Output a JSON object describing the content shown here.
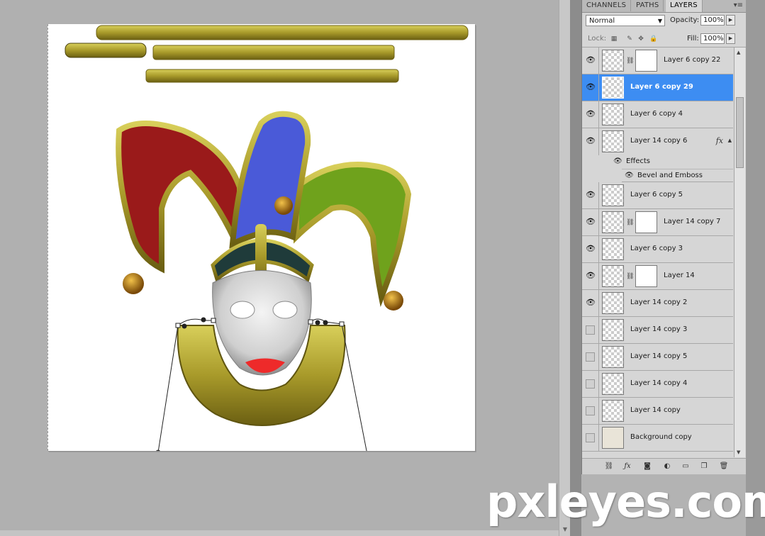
{
  "panel": {
    "tabs": [
      "CHANNELS",
      "PATHS",
      "LAYERS"
    ],
    "blend_mode": "Normal",
    "opacity_label": "Opacity:",
    "opacity_value": "100%",
    "lock_label": "Lock:",
    "fill_label": "Fill:",
    "fill_value": "100%"
  },
  "layers": [
    {
      "name": "Layer 6 copy 22",
      "visible": true,
      "mask": true,
      "selected": false
    },
    {
      "name": "Layer 6 copy 29",
      "visible": true,
      "mask": false,
      "selected": true
    },
    {
      "name": "Layer 6 copy 4",
      "visible": true,
      "mask": false,
      "selected": false
    },
    {
      "name": "Layer 14 copy 6",
      "visible": true,
      "mask": false,
      "selected": false,
      "fx": "fx"
    },
    {
      "name": "Layer 6 copy 5",
      "visible": true,
      "mask": false,
      "selected": false
    },
    {
      "name": "Layer 14 copy 7",
      "visible": true,
      "mask": true,
      "selected": false
    },
    {
      "name": "Layer 6 copy 3",
      "visible": true,
      "mask": false,
      "selected": false
    },
    {
      "name": "Layer 14",
      "visible": true,
      "mask": true,
      "selected": false
    },
    {
      "name": "Layer 14 copy 2",
      "visible": true,
      "mask": false,
      "selected": false
    },
    {
      "name": "Layer 14 copy 3",
      "visible": false,
      "mask": false,
      "selected": false
    },
    {
      "name": "Layer 14 copy 5",
      "visible": false,
      "mask": false,
      "selected": false
    },
    {
      "name": "Layer 14 copy 4",
      "visible": false,
      "mask": false,
      "selected": false
    },
    {
      "name": "Layer 14 copy",
      "visible": false,
      "mask": false,
      "selected": false
    },
    {
      "name": "Background copy",
      "visible": false,
      "mask": false,
      "selected": false
    }
  ],
  "effects": {
    "effects_label": "Effects",
    "bevel_label": "Bevel and Emboss"
  },
  "watermark": "pxleyes.com",
  "colors": {
    "selection": "#3d8df2",
    "gold": "#a89a2a",
    "red_flap": "#9a1a1a",
    "blue_flap": "#4a5ad8",
    "green_flap": "#6fa21c",
    "lips": "#ee2a2a"
  }
}
